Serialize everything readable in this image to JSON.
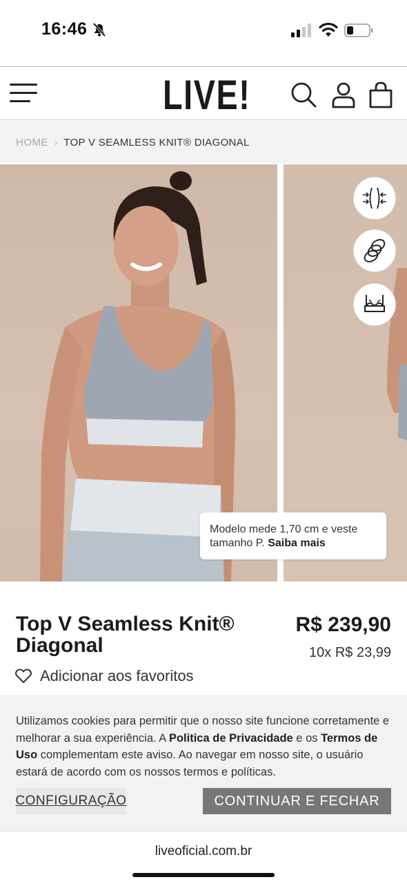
{
  "status_bar": {
    "time": "16:46"
  },
  "header": {
    "logo": "LIVE!",
    "icons": [
      "menu-icon",
      "search-icon",
      "user-icon",
      "bag-icon"
    ]
  },
  "breadcrumb": {
    "home": "HOME",
    "separator": "›",
    "current": "TOP V SEAMLESS KNIT® DIAGONAL"
  },
  "gallery": {
    "feature_icons": [
      "compression-icon",
      "rings-icon",
      "bra-icon"
    ],
    "model_note": {
      "text": "Modelo mede 1,70 cm e veste tamanho P.",
      "link": "Saiba mais"
    }
  },
  "product": {
    "title": "Top V Seamless Knit® Diagonal",
    "price": "R$ 239,90",
    "installments": "10x R$ 23,99",
    "favorite_label": "Adicionar aos favoritos"
  },
  "cookie_banner": {
    "text_1": "Utilizamos cookies para permitir que o nosso site funcione corretamente e melhorar a sua experiência. A ",
    "privacy_link": "Politica de Privacidade",
    "text_2": " e os ",
    "terms_link": "Termos de Uso",
    "text_3": " complementam este aviso. Ao navegar em nosso site, o usuário estará de acordo com os nossos termos e políticas.",
    "config_button": "CONFIGURAÇÃO",
    "continue_button": "CONTINUAR E FECHAR"
  },
  "browser": {
    "url": "liveoficial.com.br"
  },
  "colors": {
    "photo_background": "#d2bcab",
    "banner_background": "#f2f2f2",
    "continue_button": "#777777"
  }
}
